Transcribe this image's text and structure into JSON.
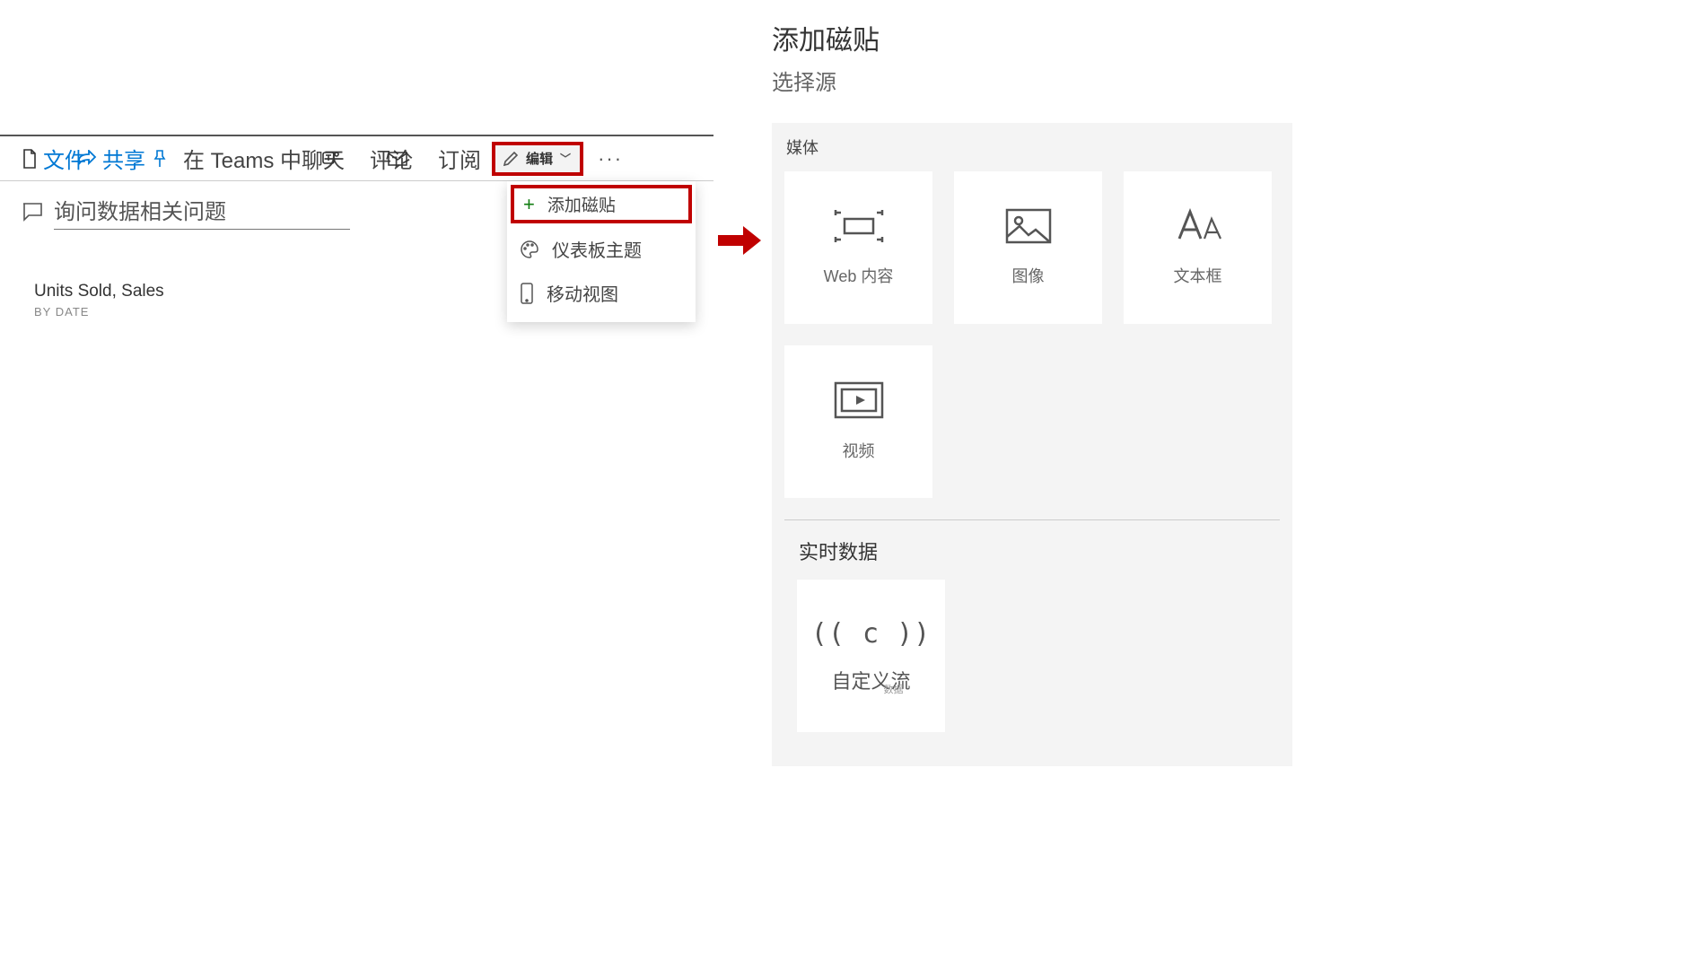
{
  "toolbar": {
    "file_label": "文件",
    "share_label": "共享",
    "teams_chat_label": "在 Teams 中聊天",
    "comment_label": "评论",
    "subscribe_label": "订阅",
    "edit_label": "编辑"
  },
  "ask": {
    "text": "询问数据相关问题"
  },
  "tile": {
    "title": "Units Sold, Sales",
    "subtitle": "BY DATE"
  },
  "edit_menu": {
    "add_tile": "添加磁贴",
    "dashboard_theme": "仪表板主题",
    "mobile_view": "移动视图"
  },
  "right": {
    "title": "添加磁贴",
    "subtitle": "选择源",
    "media_label": "媒体",
    "tiles": {
      "web_content": "Web 内容",
      "image": "图像",
      "textbox": "文本框",
      "video": "视频"
    },
    "realtime_label": "实时数据",
    "custom_stream": "自定义流",
    "custom_stream_small": "数据"
  },
  "colors": {
    "highlight_border": "#c00000",
    "plus_green": "#107c10"
  }
}
